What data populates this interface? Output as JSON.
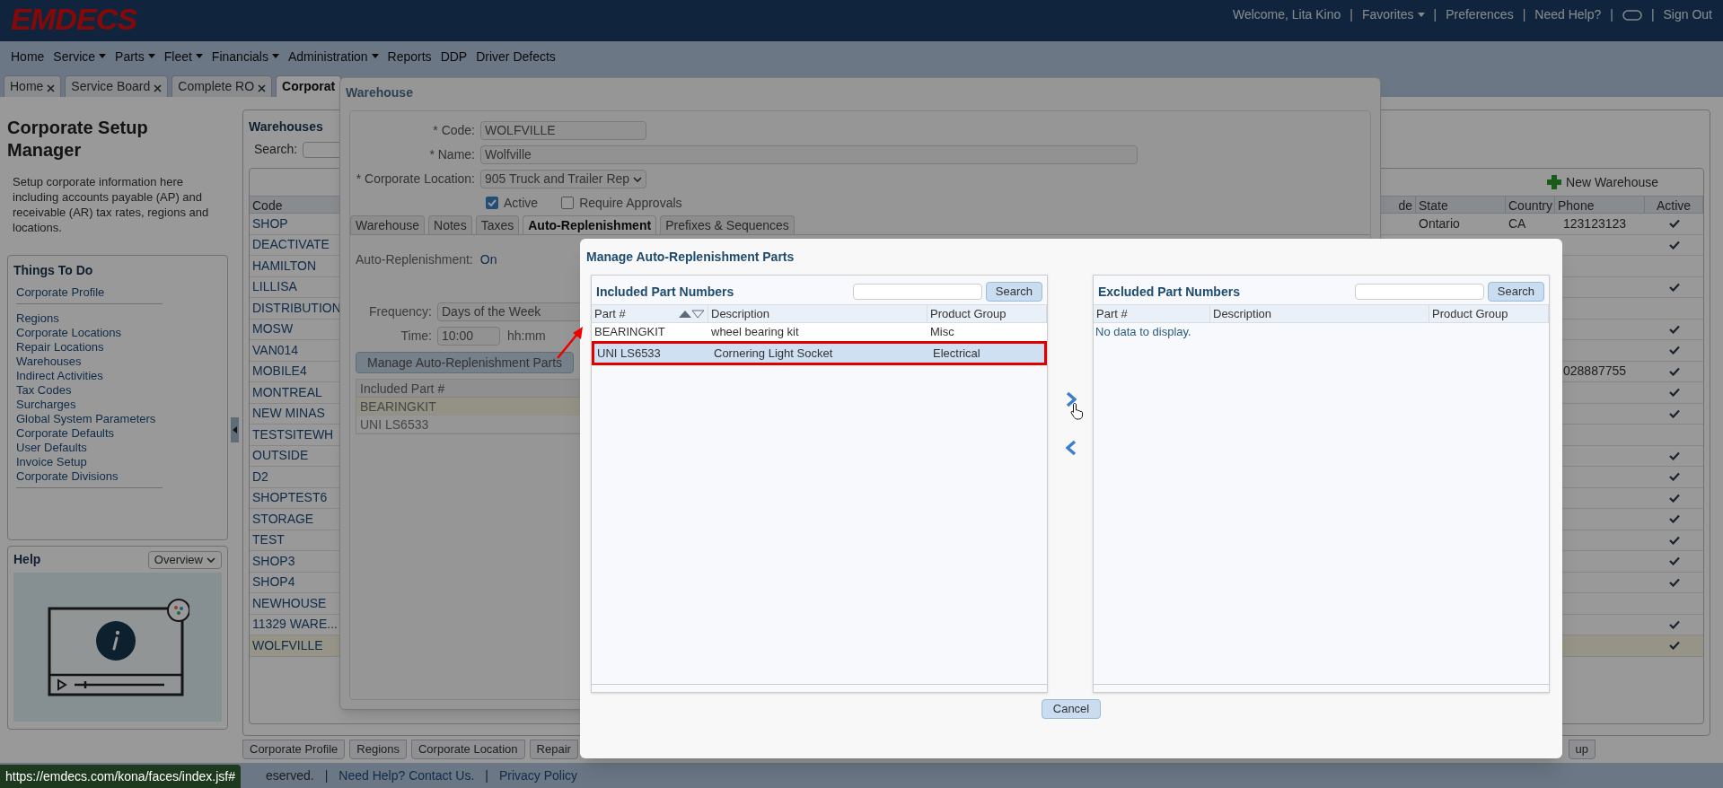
{
  "header": {
    "logo": "EMDECS",
    "links": [
      {
        "kind": "text",
        "label": "Welcome, Lita Kino"
      },
      {
        "kind": "separator",
        "label": "|"
      },
      {
        "kind": "menu",
        "label": "Favorites"
      },
      {
        "kind": "separator",
        "label": "|"
      },
      {
        "kind": "link",
        "label": "Preferences"
      },
      {
        "kind": "separator",
        "label": "|"
      },
      {
        "kind": "link",
        "label": "Need Help?"
      },
      {
        "kind": "separator",
        "label": "|"
      },
      {
        "kind": "icon"
      },
      {
        "kind": "separator",
        "label": "|"
      },
      {
        "kind": "link",
        "label": "Sign Out"
      }
    ]
  },
  "menu": [
    {
      "label": "Home",
      "dropdown": false
    },
    {
      "label": "Service",
      "dropdown": true
    },
    {
      "label": "Parts",
      "dropdown": true
    },
    {
      "label": "Fleet",
      "dropdown": true
    },
    {
      "label": "Financials",
      "dropdown": true
    },
    {
      "label": "Administration",
      "dropdown": true
    },
    {
      "label": "Reports",
      "dropdown": false
    },
    {
      "label": "DDP",
      "dropdown": false
    },
    {
      "label": "Driver Defects",
      "dropdown": false
    }
  ],
  "tabs": [
    {
      "label": "Home",
      "selected": false,
      "closable": true
    },
    {
      "label": "Service Board",
      "selected": false,
      "closable": true
    },
    {
      "label": "Complete RO",
      "selected": false,
      "closable": true
    },
    {
      "label": "Corporat",
      "selected": true,
      "closable": false
    }
  ],
  "left": {
    "title": "Corporate Setup Manager",
    "description": "Setup corporate information here including accounts payable (AP) and receivable (AR) tax rates, regions and locations.",
    "things_to_do": {
      "title": "Things To Do",
      "groups": [
        [
          "Corporate Profile"
        ],
        [
          "Regions",
          "Corporate Locations",
          "Repair Locations",
          "Warehouses",
          "Indirect Activities",
          "Tax Codes",
          "Surcharges",
          "Global System Parameters",
          "Corporate Defaults",
          "User Defaults",
          "Invoice Setup",
          "Corporate Divisions"
        ]
      ]
    },
    "help": {
      "title": "Help",
      "select": "Overview"
    }
  },
  "warehouses": {
    "title": "Warehouses",
    "search_label": "Search:",
    "new_button": "New Warehouse",
    "columns": [
      "Code",
      "de",
      "State",
      "Country",
      "Phone",
      "Active"
    ],
    "rows": [
      {
        "code": "SHOP",
        "state": "Ontario",
        "country": "CA",
        "phone": "123123123",
        "active": true,
        "selected": false
      },
      {
        "code": "DEACTIVATE",
        "active": true,
        "selected": false
      },
      {
        "code": "HAMILTON",
        "active": false,
        "selected": false
      },
      {
        "code": "LILLISA",
        "active": true,
        "selected": false
      },
      {
        "code": "DISTRIBUTION",
        "active": false,
        "selected": false
      },
      {
        "code": "MOSW",
        "active": true,
        "selected": false
      },
      {
        "code": "VAN014",
        "active": true,
        "selected": false
      },
      {
        "code": "MOBILE4",
        "phone": "028887755",
        "active": true,
        "selected": false
      },
      {
        "code": "MONTREAL",
        "active": true,
        "selected": false
      },
      {
        "code": "NEW MINAS",
        "active": true,
        "selected": false
      },
      {
        "code": "TESTSITEWH",
        "active": false,
        "selected": false
      },
      {
        "code": "OUTSIDE",
        "active": true,
        "selected": false
      },
      {
        "code": "D2",
        "active": true,
        "selected": false
      },
      {
        "code": "SHOPTEST6",
        "active": true,
        "selected": false
      },
      {
        "code": "STORAGE",
        "active": true,
        "selected": false
      },
      {
        "code": "TEST",
        "active": true,
        "selected": false
      },
      {
        "code": "SHOP3",
        "active": true,
        "selected": false
      },
      {
        "code": "SHOP4",
        "active": true,
        "selected": false
      },
      {
        "code": "NEWHOUSE",
        "active": false,
        "selected": false
      },
      {
        "code": "11329 WARE...",
        "active": true,
        "selected": false
      },
      {
        "code": "WOLFVILLE",
        "active": true,
        "selected": true
      }
    ]
  },
  "bottom_tabs": [
    "Corporate Profile",
    "Regions",
    "Corporate Location",
    "Repair",
    "up"
  ],
  "footer": {
    "status_url": "https://emdecs.com/kona/faces/index.jsf#",
    "items": [
      {
        "kind": "text",
        "label": "eserved."
      },
      {
        "kind": "separator",
        "label": "|"
      },
      {
        "kind": "link",
        "label": "Need Help? Contact Us."
      },
      {
        "kind": "separator",
        "label": "|"
      },
      {
        "kind": "link",
        "label": "Privacy Policy"
      }
    ]
  },
  "warehouse_dialog": {
    "title": "Warehouse",
    "fields": [
      {
        "kind": "text",
        "label": "* Code:",
        "value": "WOLFVILLE"
      },
      {
        "kind": "wide",
        "label": "* Name:",
        "value": "Wolfville"
      },
      {
        "kind": "select",
        "label": "* Corporate Location:",
        "value": "905 Truck and Trailer Rep"
      }
    ],
    "checkboxes": [
      {
        "label": "Active",
        "checked": true
      },
      {
        "label": "Require Approvals",
        "checked": false
      }
    ],
    "tabs": [
      {
        "label": "Warehouse",
        "selected": false
      },
      {
        "label": "Notes",
        "selected": false
      },
      {
        "label": "Taxes",
        "selected": false
      },
      {
        "label": "Auto-Replenishment",
        "selected": true
      },
      {
        "label": "Prefixes & Sequences",
        "selected": false
      }
    ],
    "auto_replenishment": {
      "label": "Auto-Replenishment:",
      "value": "On"
    },
    "frequency": {
      "label": "Frequency:",
      "value": "Days of the Week"
    },
    "time": {
      "label": "Time:",
      "value": "10:00",
      "hint": "hh:mm"
    },
    "manage_button": "Manage Auto-Replenishment Parts",
    "parts_table": {
      "column": "Included Part #",
      "rows": [
        {
          "part": "BEARINGKIT",
          "selected": true
        },
        {
          "part": "UNI LS6533",
          "selected": false
        }
      ]
    }
  },
  "modal": {
    "title": "Manage Auto-Replenishment Parts",
    "included": {
      "title": "Included Part Numbers",
      "search_button": "Search",
      "columns": [
        "Part #",
        "Description",
        "Product Group"
      ],
      "rows": [
        {
          "part": "BEARINGKIT",
          "description": "wheel bearing kit",
          "group": "Misc",
          "selected": false
        },
        {
          "part": "UNI LS6533",
          "description": "Cornering Light Socket",
          "group": "Electrical",
          "selected": true
        }
      ]
    },
    "excluded": {
      "title": "Excluded Part Numbers",
      "search_button": "Search",
      "columns": [
        "Part #",
        "Description",
        "Product Group"
      ],
      "empty_text": "No data to display."
    },
    "cancel": "Cancel"
  }
}
